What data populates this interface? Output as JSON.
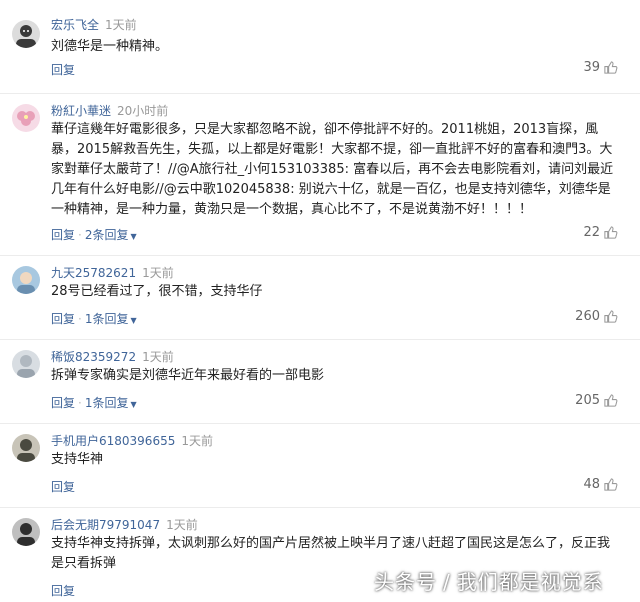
{
  "comments": [
    {
      "username": "宏乐飞全",
      "time": "1天前",
      "content": "刘德华是一种精神。",
      "reply_label": "回复",
      "replies_label": "",
      "likes": "39",
      "avatar_color": "#3a3a3a"
    },
    {
      "username": "粉紅小華迷",
      "time": "20小时前",
      "content": "華仔這幾年好電影很多，只是大家都忽略不說，卻不停批評不好的。2011桃姐，2013盲探，風暴，2015解救吾先生，失孤，以上都是好電影！大家都不提，卻一直批評不好的富春和澳門3。大家對華仔太嚴苛了！//@A旅行社_小何153103385: 富春以后，再不会去电影院看刘，请问刘最近几年有什么好电影//@云中歌102045838: 别说六十亿，就是一百亿，也是支持刘德华，刘德华是一种精神，是一种力量，黄渤只是一个数据，真心比不了，不是说黄渤不好！！！！",
      "reply_label": "回复",
      "replies_label": "2条回复",
      "likes": "22",
      "avatar_color": "#e8a0b8"
    },
    {
      "username": "九天25782621",
      "time": "1天前",
      "content": "28号已经看过了，很不错，支持华仔",
      "reply_label": "回复",
      "replies_label": "1条回复",
      "likes": "260",
      "avatar_color": "#7aa7c7"
    },
    {
      "username": "稀饭82359272",
      "time": "1天前",
      "content": "拆弹专家确实是刘德华近年来最好看的一部电影",
      "reply_label": "回复",
      "replies_label": "1条回复",
      "likes": "205",
      "avatar_color": "#b0b8c0"
    },
    {
      "username": "手机用户6180396655",
      "time": "1天前",
      "content": "支持华神",
      "reply_label": "回复",
      "replies_label": "",
      "likes": "48",
      "avatar_color": "#4a4a40"
    },
    {
      "username": "后会无期79791047",
      "time": "1天前",
      "content": "支持华神支持拆弹，太讽刺那么好的国产片居然被上映半月了速八赶超了国民这是怎么了，反正我是只看拆弹",
      "reply_label": "回复",
      "replies_label": "",
      "likes": "",
      "avatar_color": "#2e2e2e"
    }
  ],
  "watermark": {
    "left": "头条号",
    "slash": "/",
    "right": "我们都是视觉系"
  }
}
